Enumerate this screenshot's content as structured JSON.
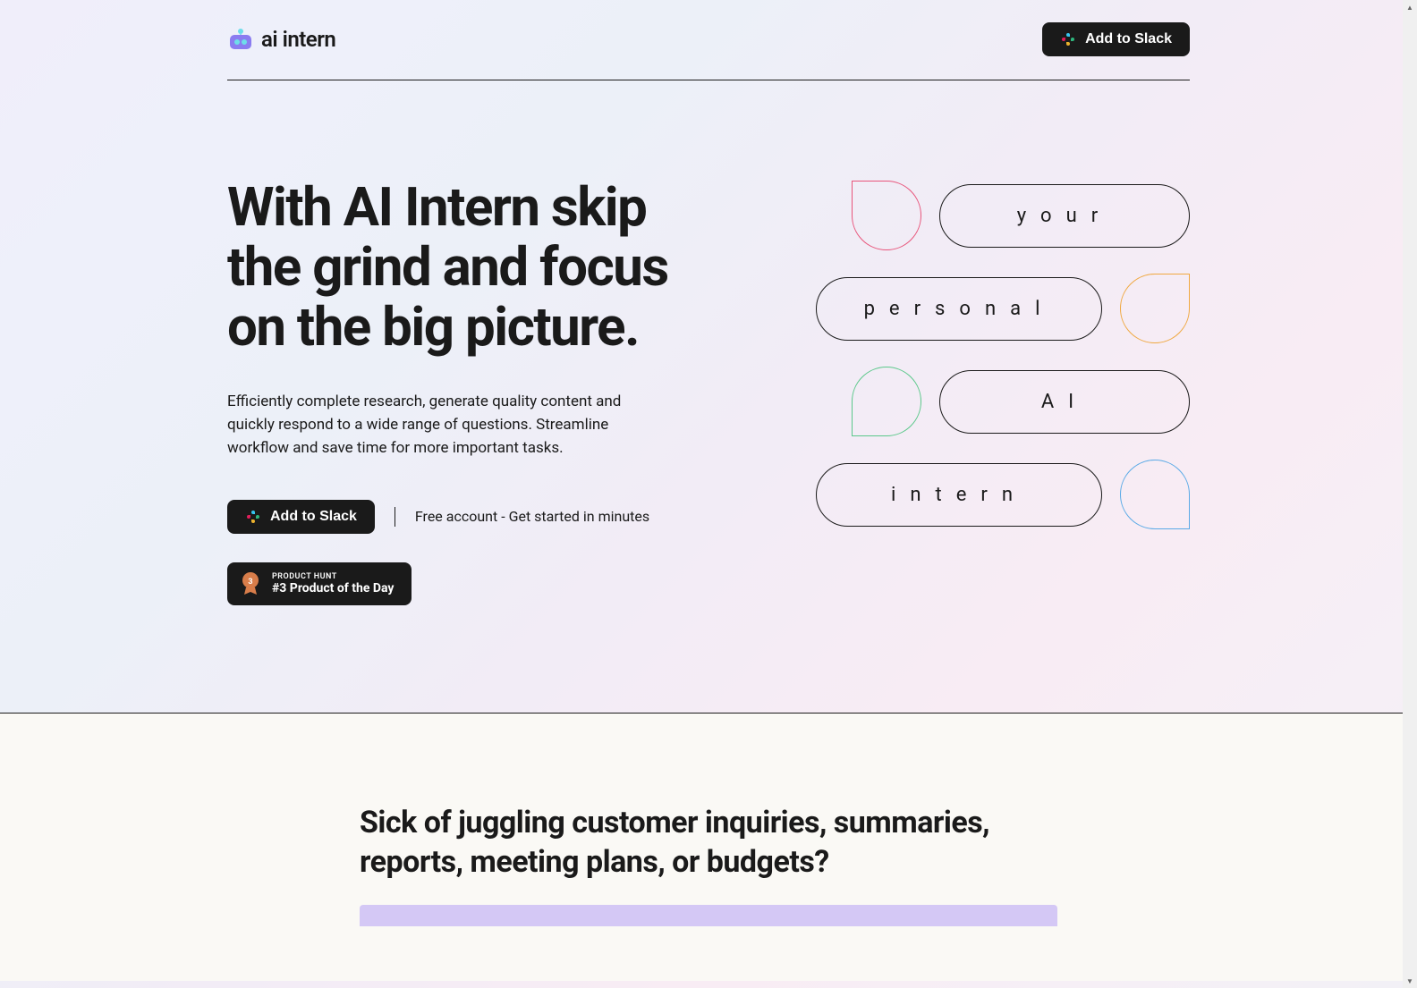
{
  "header": {
    "logo_text": "ai intern",
    "add_to_slack": "Add to Slack"
  },
  "hero": {
    "title": "With AI Intern skip the grind and focus on the big picture.",
    "subtitle": "Efficiently complete research, generate quality content and quickly respond to a wide range of questions. Streamline workflow and save time for more important tasks.",
    "cta_button": "Add to Slack",
    "free_text": "Free account - Get started in minutes",
    "ph_label": "PRODUCT HUNT",
    "ph_title": "#3 Product of the Day",
    "ph_rank": "3",
    "pills": {
      "your": "your",
      "personal": "personal",
      "ai": "AI",
      "intern": "intern"
    }
  },
  "section2": {
    "title": "Sick of juggling customer inquiries, summaries, reports, meeting plans, or budgets?"
  },
  "colors": {
    "pink": "#e8547a",
    "orange": "#f0a840",
    "green": "#5ac88a",
    "blue": "#5aaae6",
    "dark": "#1a1a1a",
    "purple": "#d4c8f5"
  }
}
